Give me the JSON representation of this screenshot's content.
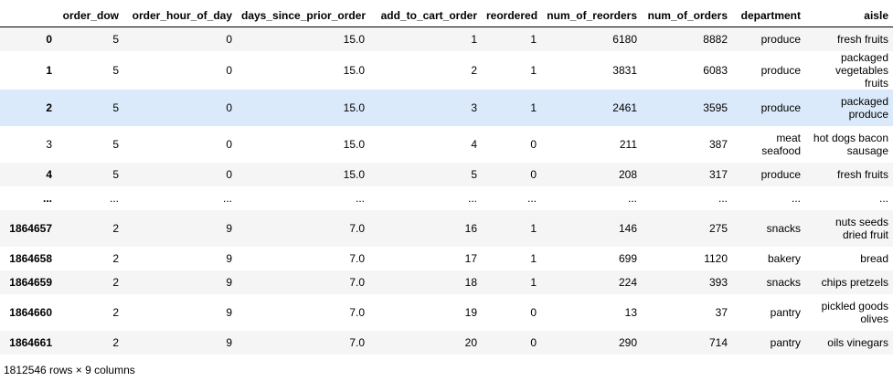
{
  "dataframe": {
    "columns": [
      "",
      "order_dow",
      "order_hour_of_day",
      "days_since_prior_order",
      "add_to_cart_order",
      "reordered",
      "num_of_reorders",
      "num_of_orders",
      "department",
      "aisle"
    ],
    "rows": [
      [
        "0",
        "5",
        "0",
        "15.0",
        "1",
        "1",
        "6180",
        "8882",
        "produce",
        "fresh fruits"
      ],
      [
        "1",
        "5",
        "0",
        "15.0",
        "2",
        "1",
        "3831",
        "6083",
        "produce",
        "packaged vegetables fruits"
      ],
      [
        "2",
        "5",
        "0",
        "15.0",
        "3",
        "1",
        "2461",
        "3595",
        "produce",
        "packaged produce"
      ],
      [
        "3",
        "5",
        "0",
        "15.0",
        "4",
        "0",
        "211",
        "387",
        "meat seafood",
        "hot dogs bacon sausage"
      ],
      [
        "4",
        "5",
        "0",
        "15.0",
        "5",
        "0",
        "208",
        "317",
        "produce",
        "fresh fruits"
      ],
      [
        "...",
        "...",
        "...",
        "...",
        "...",
        "...",
        "...",
        "...",
        "...",
        "..."
      ],
      [
        "1864657",
        "2",
        "9",
        "7.0",
        "16",
        "1",
        "146",
        "275",
        "snacks",
        "nuts seeds dried fruit"
      ],
      [
        "1864658",
        "2",
        "9",
        "7.0",
        "17",
        "1",
        "699",
        "1120",
        "bakery",
        "bread"
      ],
      [
        "1864659",
        "2",
        "9",
        "7.0",
        "18",
        "1",
        "224",
        "393",
        "snacks",
        "chips pretzels"
      ],
      [
        "1864660",
        "2",
        "9",
        "7.0",
        "19",
        "0",
        "13",
        "37",
        "pantry",
        "pickled goods olives"
      ],
      [
        "1864661",
        "2",
        "9",
        "7.0",
        "20",
        "0",
        "290",
        "714",
        "pantry",
        "oils vinegars"
      ]
    ],
    "summary": "1812546 rows × 9 columns"
  }
}
